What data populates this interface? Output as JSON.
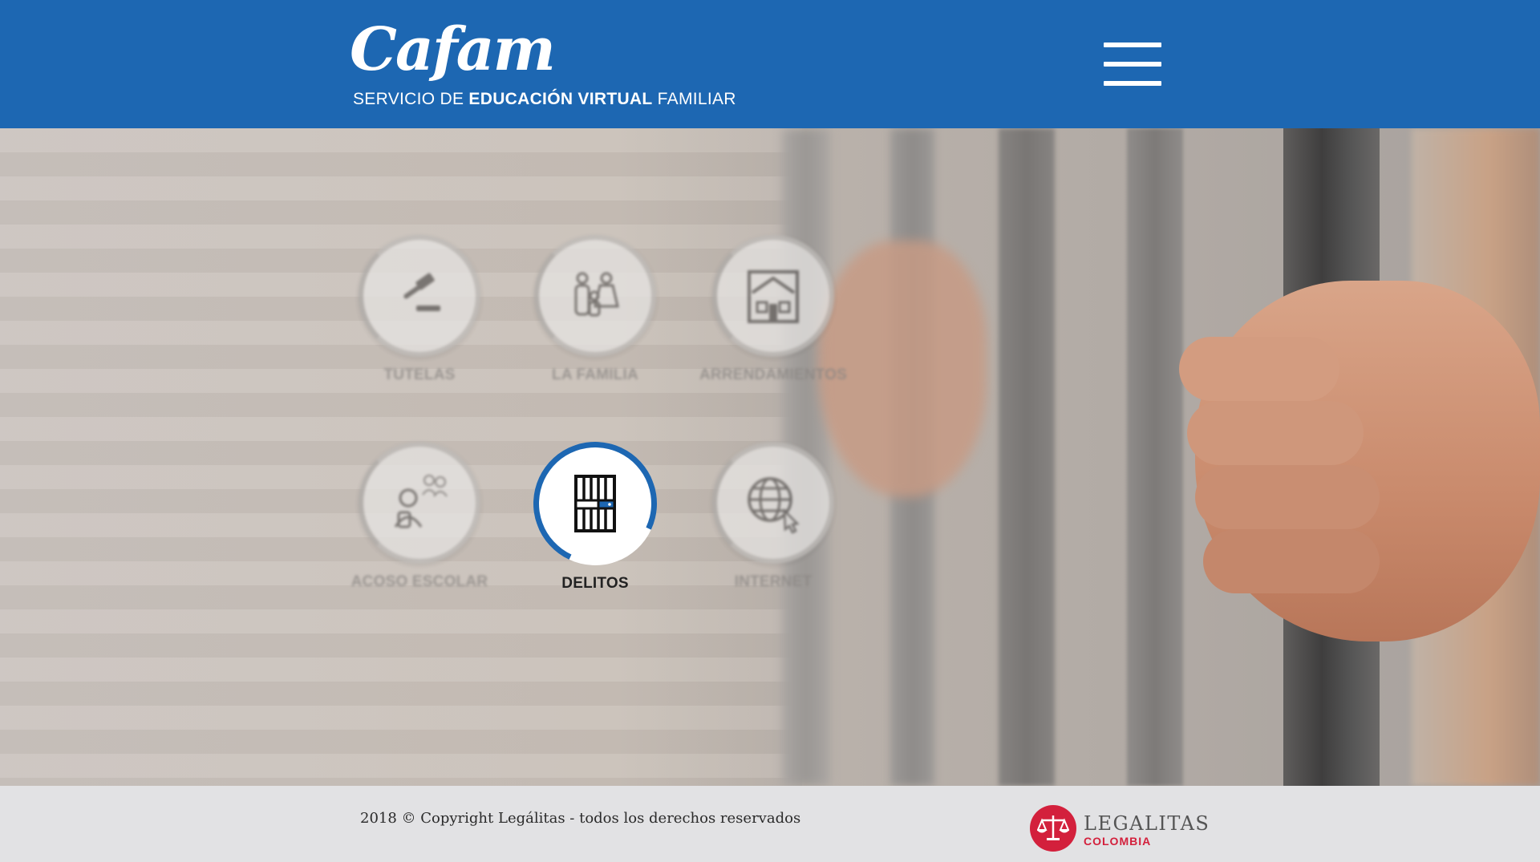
{
  "header": {
    "logo_text": "Cafam",
    "tagline_prefix": "SERVICIO DE ",
    "tagline_bold": "EDUCACIÓN VIRTUAL",
    "tagline_suffix": " FAMILIAR",
    "menu_icon": "hamburger-menu-icon"
  },
  "topics": [
    {
      "label": "TUTELAS",
      "icon": "gavel-icon",
      "active": false
    },
    {
      "label": "LA FAMILIA",
      "icon": "family-icon",
      "active": false
    },
    {
      "label": "ARRENDAMIENTOS",
      "icon": "house-icon",
      "active": false
    },
    {
      "label": "ACOSO ESCOLAR",
      "icon": "bullying-icon",
      "active": false
    },
    {
      "label": "DELITOS",
      "icon": "jail-bars-icon",
      "active": true
    },
    {
      "label": "INTERNET",
      "icon": "globe-cursor-icon",
      "active": false
    }
  ],
  "footer": {
    "copyright": "2018 © Copyright Legálitas - todos los derechos reservados",
    "partner_name": "LEGALITAS",
    "partner_country": "COLOMBIA",
    "partner_icon": "scales-icon"
  },
  "colors": {
    "brand_blue": "#1d67b2",
    "partner_red": "#d3203c",
    "footer_bg": "#e2e2e4"
  }
}
